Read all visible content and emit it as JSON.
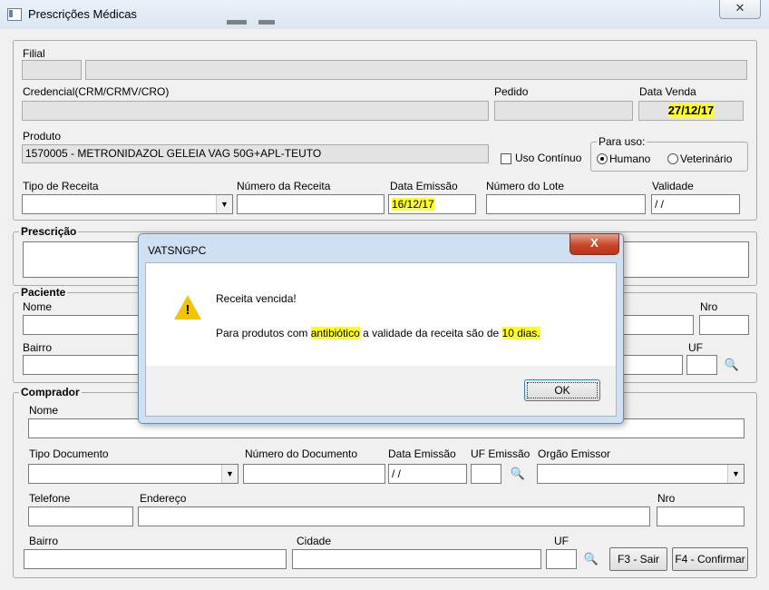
{
  "window": {
    "title": "Prescrições Médicas",
    "close_glyph": "✕"
  },
  "top": {
    "filial_label": "Filial",
    "credencial_label": "Credencial(CRM/CRMV/CRO)",
    "pedido_label": "Pedido",
    "data_venda_label": "Data Venda",
    "data_venda_value": "27/12/17",
    "produto_label": "Produto",
    "produto_value": "1570005 - METRONIDAZOL GELEIA VAG 50G+APL-TEUTO",
    "uso_continuo_label": "Uso Contínuo",
    "para_uso_label": "Para uso:",
    "humano_label": "Humano",
    "veterinario_label": "Veterinário",
    "tipo_receita_label": "Tipo de Receita",
    "numero_receita_label": "Número da Receita",
    "data_emissao_label": "Data Emissão",
    "data_emissao_value": "16/12/17",
    "numero_lote_label": "Número do Lote",
    "validade_label": "Validade",
    "validade_value": " / /"
  },
  "prescricao": {
    "title": "Prescrição"
  },
  "paciente": {
    "title": "Paciente",
    "nome_label": "Nome",
    "nro_label": "Nro",
    "bairro_label": "Bairro",
    "uf_label": "UF"
  },
  "comprador": {
    "title": "Comprador",
    "nome_label": "Nome",
    "tipo_documento_label": "Tipo Documento",
    "numero_documento_label": "Número do Documento",
    "data_emissao_label": "Data Emissão",
    "data_emissao_value": " / /",
    "uf_emissao_label": "UF Emissão",
    "orgao_emissor_label": "Orgão Emissor",
    "telefone_label": "Telefone",
    "endereco_label": "Endereço",
    "nro_label": "Nro",
    "bairro_label": "Bairro",
    "cidade_label": "Cidade",
    "uf_label": "UF"
  },
  "buttons": {
    "sair": "F3 - Sair",
    "confirmar": "F4 - Confirmar"
  },
  "dialog": {
    "title": "VATSNGPC",
    "close_glyph": "X",
    "line1": "Receita vencida!",
    "line2_pre": "Para produtos com ",
    "line2_hl1": "antibiótico",
    "line2_mid": " a validade da receita são de ",
    "line2_hl2": "10 dias.",
    "ok_label": "OK",
    "icon": "warning-icon"
  },
  "icons": {
    "binoculars": "binoculars-icon",
    "combo": "chevron-down-icon",
    "binoculars_glyph": "🔍",
    "combo_glyph": "▼"
  },
  "colors": {
    "highlight": "#ffff2d",
    "dialog_frame": "#cfe0f3",
    "dialog_close": "#c7452a"
  }
}
